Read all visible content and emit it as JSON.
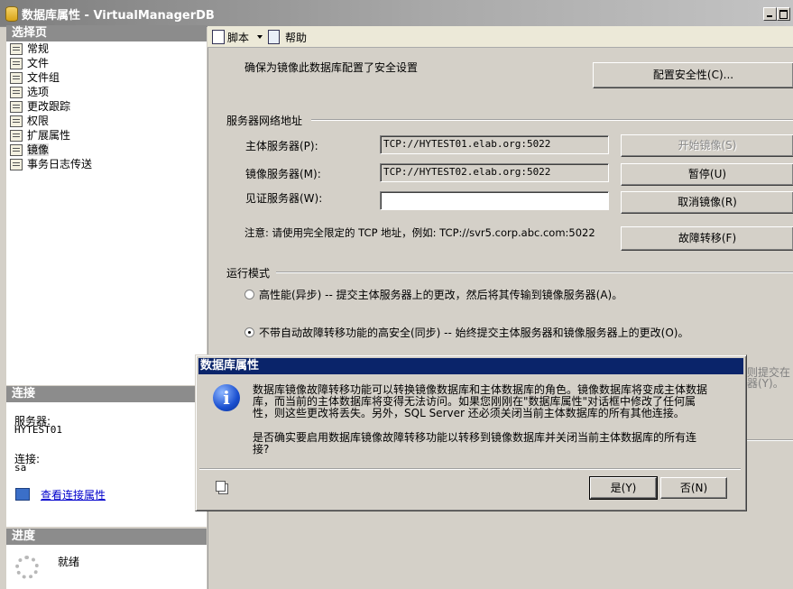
{
  "window": {
    "title": "数据库属性 - VirtualManagerDB"
  },
  "left": {
    "select_page_header": "选择页",
    "pages": [
      "常规",
      "文件",
      "文件组",
      "选项",
      "更改跟踪",
      "权限",
      "扩展属性",
      "镜像",
      "事务日志传送"
    ],
    "connection_header": "连接",
    "server_label": "服务器:",
    "server_value": "HYTEST01",
    "connection_label": "连接:",
    "connection_value": "sa",
    "view_connection_link": "查看连接属性",
    "progress_header": "进度",
    "progress_status": "就绪"
  },
  "toolbar": {
    "script": "脚本",
    "help": "帮助"
  },
  "mirroring": {
    "security_note": "确保为镜像此数据库配置了安全设置",
    "configure_security_button": "配置安全性(C)...",
    "network_section": "服务器网络地址",
    "principal_label": "主体服务器(P):",
    "principal_value": "TCP://HYTEST01.elab.org:5022",
    "mirror_label": "镜像服务器(M):",
    "mirror_value": "TCP://HYTEST02.elab.org:5022",
    "witness_label": "见证服务器(W):",
    "witness_value": "",
    "start_button": "开始镜像(S)",
    "pause_button": "暂停(U)",
    "remove_button": "取消镜像(R)",
    "failover_button": "故障转移(F)",
    "note": "注意: 请使用完全限定的 TCP 地址，例如: TCP://svr5.corp.abc.com:5022",
    "mode_section": "运行模式",
    "mode_high_perf": "高性能(异步) -- 提交主体服务器上的更改，然后将其传输到镜像服务器(A)。",
    "mode_high_safety": "不带自动故障转移功能的高安全(同步) -- 始终提交主体服务器和镜像服务器上的更改(O)。",
    "clipped_right_1": "则提交在",
    "clipped_right_2": "器(Y)。"
  },
  "dialog": {
    "title": "数据库属性",
    "message_lines": [
      "数据库镜像故障转移功能可以转换镜像数据库和主体数据库的角色。镜像数据库将变成主体数据",
      "库，而当前的主体数据库将变得无法访问。如果您刚刚在\"数据库属性\"对话框中修改了任何属",
      "性，则这些更改将丢失。另外，SQL Server 还必须关闭当前主体数据库的所有其他连接。"
    ],
    "question_lines": [
      "是否确实要启用数据库镜像故障转移功能以转移到镜像数据库并关闭当前主体数据库的所有连",
      "接?"
    ],
    "yes_button": "是(Y)",
    "no_button": "否(N)"
  }
}
